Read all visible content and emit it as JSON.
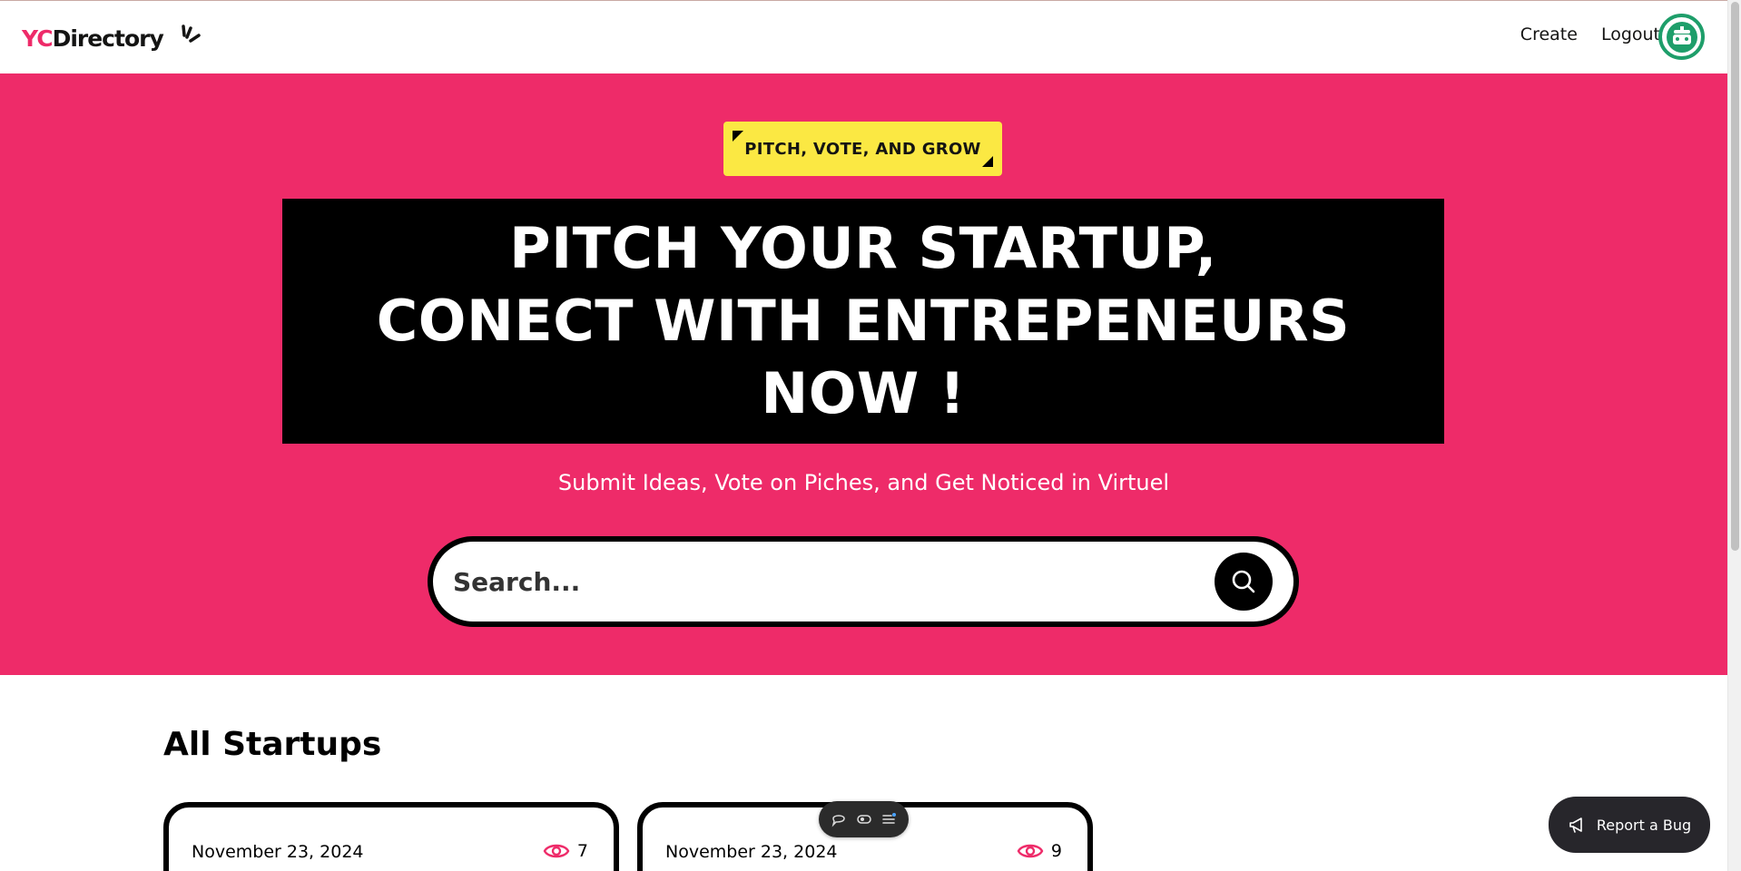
{
  "brand": {
    "prefix": "YC",
    "name": "Directory",
    "accent": "#ee2b69"
  },
  "nav": {
    "create_label": "Create",
    "logout_label": "Logout",
    "avatar_icon": "robot-avatar-icon"
  },
  "hero": {
    "tag": "PITCH, VOTE, AND GROW",
    "headline_line1": "PITCH YOUR STARTUP,",
    "headline_line2": "CONECT WITH ENTREPENEURS",
    "headline_line3": "NOW !",
    "subheading": "Submit Ideas, Vote on Piches, and Get Noticed in Virtuel",
    "background": "#ee2b69",
    "tag_color": "#fbe843"
  },
  "search": {
    "placeholder": "Search...",
    "value": ""
  },
  "startups": {
    "title": "All Startups",
    "cards": [
      {
        "date": "November 23, 2024",
        "views": "7"
      },
      {
        "date": "November 23, 2024",
        "views": "9"
      }
    ]
  },
  "toolbar": {
    "icons": [
      "comment-icon",
      "toggle-icon",
      "menu-icon"
    ]
  },
  "bug_report": {
    "label": "Report a Bug",
    "icon": "megaphone-icon"
  }
}
